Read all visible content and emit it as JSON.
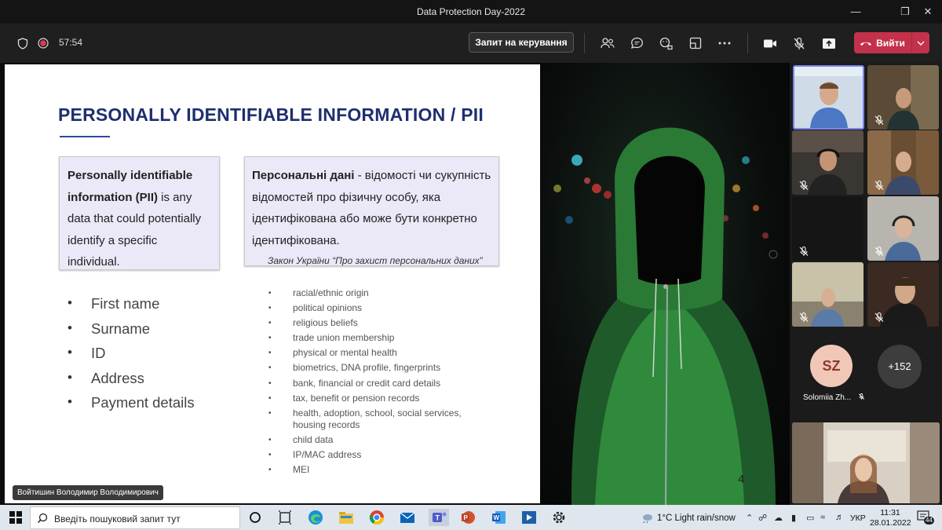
{
  "window": {
    "title": "Data Protection Day-2022"
  },
  "toolbar": {
    "timer": "57:54",
    "request_control_label": "Запит на керування",
    "leave_label": "Вийти"
  },
  "slide": {
    "title": "PERSONALLY IDENTIFIABLE INFORMATION / PII",
    "box_en": {
      "bold": "Personally identifiable information (PII)",
      "text": " is any data that could potentially identify a specific individual."
    },
    "box_uk": {
      "bold": "Персональні дані",
      "text": " - відомості чи сукупність відомостей про фізичну особу, яка ідентифікована або може бути конкретно ідентифікована.",
      "law": "Закон України “Про захист персональних даних”"
    },
    "pii_items": [
      "First name",
      "Surname",
      "ID",
      "Address",
      "Payment details"
    ],
    "sensitive_items": [
      "racial/ethnic origin",
      "political opinions",
      "religious beliefs",
      "trade union membership",
      "physical or mental health",
      "biometrics, DNA profile, fingerprints",
      "bank, financial or credit card details",
      "tax, benefit or pension records",
      "health, adoption, school, social services, housing records",
      "child data",
      "IP/MAC address",
      "MEI"
    ],
    "page_number": "4"
  },
  "presenter": {
    "name": "Войтишин Володимир Володимирович"
  },
  "participants": {
    "avatar_initials": "SZ",
    "avatar_name": "Solomiia Zh...",
    "more_count": "+152"
  },
  "taskbar": {
    "search_placeholder": "Введіть пошуковий запит тут",
    "weather": "1°C  Light rain/snow",
    "language": "УКР",
    "time": "11:31",
    "date": "28.01.2022",
    "notification_count": "44"
  },
  "colors": {
    "accent_leave": "#c4314b",
    "slide_title": "#1d2f6f",
    "box_bg": "#ebe8f8",
    "hood_green": "#2f8a3c"
  }
}
